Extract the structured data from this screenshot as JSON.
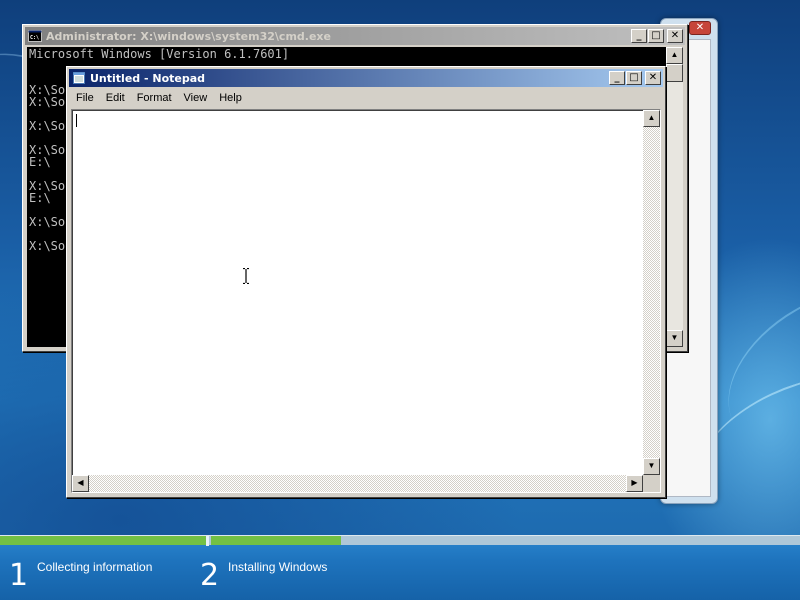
{
  "cmd_window": {
    "title": "Administrator: X:\\windows\\system32\\cmd.exe",
    "lines": [
      "Microsoft Windows [Version 6.1.7601]",
      "",
      "",
      "X:\\So",
      "X:\\So",
      "",
      "X:\\So",
      "",
      "X:\\So",
      "E:\\",
      "",
      "X:\\So",
      "E:\\",
      "",
      "X:\\So",
      "",
      "X:\\So"
    ],
    "minimize": "_",
    "maximize": "□",
    "close": "✕"
  },
  "notepad": {
    "title": "Untitled - Notepad",
    "menu": [
      "File",
      "Edit",
      "Format",
      "View",
      "Help"
    ],
    "content": "",
    "minimize": "_",
    "maximize": "□",
    "close": "✕"
  },
  "setup": {
    "close": "✕",
    "steps": [
      {
        "number": "1",
        "label": "Collecting information"
      },
      {
        "number": "2",
        "label": "Installing Windows"
      }
    ],
    "progress": {
      "step1_fraction": 1.0,
      "step2_fraction": 0.22
    }
  },
  "icons": {
    "cmd": "console-icon",
    "notepad": "notepad-icon",
    "cursor": "text-cursor-icon"
  },
  "colors": {
    "active_title": "#0a246a",
    "inactive_title": "#808080",
    "progress": "#73c045"
  }
}
